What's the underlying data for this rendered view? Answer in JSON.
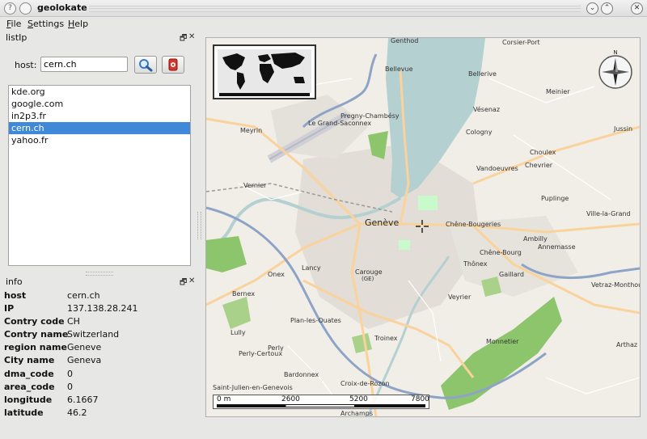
{
  "window": {
    "title": "geolokate",
    "help_glyph": "?",
    "minimize_glyph": "⌄",
    "maximize_glyph": "⌃",
    "close_glyph": "✕"
  },
  "menu": {
    "file": {
      "mnemonic": "F",
      "rest": "ile"
    },
    "settings": {
      "mnemonic": "S",
      "rest": "ettings"
    },
    "help": {
      "mnemonic": "H",
      "rest": "elp"
    }
  },
  "listip_dock": {
    "title": "listIp",
    "float_glyph": "🗗",
    "close_glyph": "✕",
    "host_label": "host:",
    "host_value": "cern.ch",
    "search_icon": "search-icon",
    "locate_icon": "locate-icon",
    "hosts": [
      "kde.org",
      "google.com",
      "in2p3.fr",
      "cern.ch",
      "yahoo.fr"
    ],
    "selected_index": 3
  },
  "info_dock": {
    "title": "info",
    "float_glyph": "🗗",
    "close_glyph": "✕",
    "rows": [
      {
        "key": "host",
        "value": "cern.ch"
      },
      {
        "key": "IP",
        "value": "137.138.28.241"
      },
      {
        "key": "Contry code",
        "value": "CH"
      },
      {
        "key": "Contry name",
        "value": "Switzerland"
      },
      {
        "key": "region name",
        "value": "Geneve"
      },
      {
        "key": "City name",
        "value": "Geneva"
      },
      {
        "key": "dma_code",
        "value": "0"
      },
      {
        "key": "area_code",
        "value": "0"
      },
      {
        "key": "longitude",
        "value": "6.1667"
      },
      {
        "key": "latitude",
        "value": "46.2"
      }
    ]
  },
  "map": {
    "compass_north": "N",
    "scale_labels": [
      "0 m",
      "2600",
      "5200",
      "7800"
    ],
    "place_labels": {
      "genthod": "Genthod",
      "corsier_port": "Corsier-Port",
      "bellevue": "Bellevue",
      "bellerive": "Bellerive",
      "meinier": "Meinier",
      "vesenaz": "Vésenaz",
      "jussin": "Jussin",
      "pregny": "Pregny-Chambésy",
      "grand_saconnex": "Le Grand-Saconnex",
      "meyrin": "Meyrin",
      "cologny": "Cologny",
      "choulex": "Choulex",
      "chevrier": "Chevrier",
      "vandoeuvres": "Vandoeuvres",
      "vernier": "Vernier",
      "puplinge": "Puplinge",
      "ville_la_grand": "Ville-la-Grand",
      "geneve": "Genève",
      "chene_bougeries": "Chêne-Bougeries",
      "ambilly": "Ambilly",
      "annemasse": "Annemasse",
      "chene_bourg": "Chêne-Bourg",
      "thonex": "Thônex",
      "lancy": "Lancy",
      "onex": "Onex",
      "carouge": "Carouge",
      "ge": "(GE)",
      "gaillard": "Gaillard",
      "bernex": "Bernex",
      "vetraz": "Vetraz-Monthoux",
      "veyrier": "Veyrier",
      "plan_les_ouates": "Plan-les-Ouates",
      "lully": "Lully",
      "troinex": "Troinex",
      "monnetier": "Monnetier",
      "arthaz": "Arthaz",
      "perly": "Perly",
      "perly_certoux": "Perly-Certoux",
      "bardonnex": "Bardonnex",
      "saint_julien": "Saint-Julien-en-Genevois",
      "croix_de_rozon": "Croix-de-Rozon",
      "archamps": "Archamps"
    },
    "colors": {
      "lake": "#b5d0d0",
      "forest": "#8dc56c",
      "park": "#c8facc",
      "road_major": "#f9d29c",
      "motorway": "#8ea4c6",
      "urban": "#e0dfdf"
    }
  }
}
